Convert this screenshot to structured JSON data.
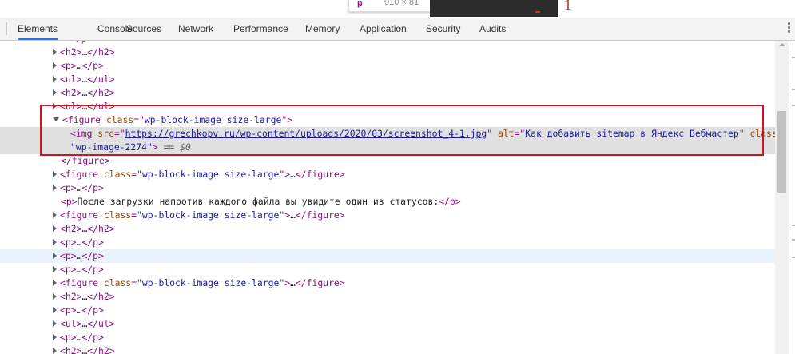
{
  "overlay": {
    "tooltip_tag": "p",
    "tooltip_dims": "910 × 81",
    "annotation_number": "1"
  },
  "tabs": [
    "Elements",
    "Console",
    "Sources",
    "Network",
    "Performance",
    "Memory",
    "Application",
    "Security",
    "Audits"
  ],
  "active_tab": "Elements",
  "dom_tree": {
    "rows": [
      {
        "open": "</p>"
      },
      {
        "tag": "h2",
        "collapsed": true
      },
      {
        "tag": "p",
        "collapsed": true
      },
      {
        "tag": "ul",
        "collapsed": true
      },
      {
        "tag": "h2",
        "collapsed": true
      },
      {
        "tag": "ul",
        "collapsed": true
      },
      {
        "figure_open": {
          "tag": "figure",
          "attr": "class",
          "value": "wp-block-image size-large"
        }
      },
      {
        "img": {
          "tag": "img",
          "src_attr": "src",
          "src": "https://grechkopv.ru/wp-content/uploads/2020/03/screenshot_4-1.jpg",
          "alt_attr": "alt",
          "alt": "Как добавить sitemap в Яндекс Вебмастер",
          "class_attr": "class",
          "class": "wp-image-2274",
          "selected_marker": "== $0"
        }
      },
      {
        "close": "</figure>"
      },
      {
        "tag": "figure",
        "attr": "class",
        "value": "wp-block-image size-large",
        "collapsed": true
      },
      {
        "tag": "p",
        "collapsed": true
      },
      {
        "text_p": "После загрузки напротив каждого файла вы увидите один из статусов:"
      },
      {
        "tag": "figure",
        "attr": "class",
        "value": "wp-block-image size-large",
        "collapsed": true
      },
      {
        "tag": "h2",
        "collapsed": true
      },
      {
        "tag": "p",
        "collapsed": true
      },
      {
        "tag": "p",
        "collapsed": true,
        "hover": true
      },
      {
        "tag": "p",
        "collapsed": true
      },
      {
        "tag": "figure",
        "attr": "class",
        "value": "wp-block-image size-large",
        "collapsed": true
      },
      {
        "tag": "h2",
        "collapsed": true
      },
      {
        "tag": "p",
        "collapsed": true
      },
      {
        "tag": "ul",
        "collapsed": true
      },
      {
        "tag": "p",
        "collapsed": true
      },
      {
        "tag": "h2",
        "collapsed": true
      }
    ],
    "ellipsis": "…"
  },
  "colors": {
    "tag": "#881280",
    "attr_name": "#994500",
    "attr_value": "#1a1aa6",
    "annotation": "#d0151e",
    "active_tab_underline": "#1a73e8"
  }
}
